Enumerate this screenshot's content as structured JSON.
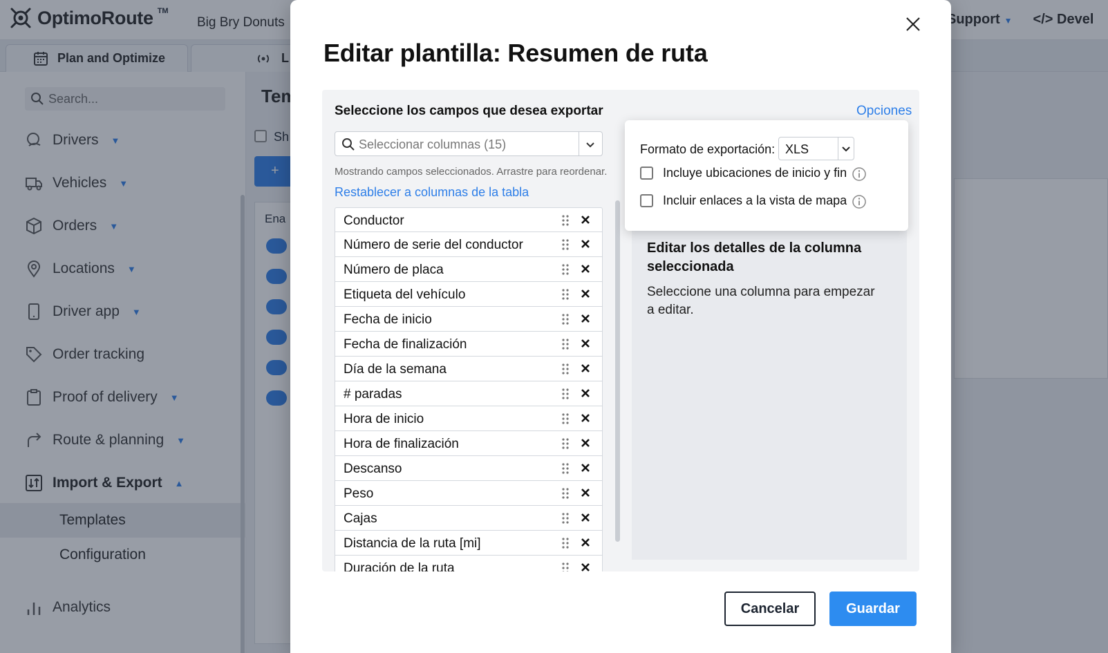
{
  "app": {
    "brand": "OptimoRoute",
    "brand_tm": "TM",
    "company": "Big Bry Donuts",
    "top_links": [
      "Support",
      "Devel"
    ]
  },
  "tabs": [
    {
      "label": "Plan and Optimize",
      "icon": "calendar-icon"
    },
    {
      "label": "L",
      "icon": "live-broadcast-icon"
    }
  ],
  "sidebar": {
    "search_placeholder": "Search...",
    "items": [
      {
        "label": "Drivers",
        "icon": "drivers-icon",
        "caret": true
      },
      {
        "label": "Vehicles",
        "icon": "truck-icon",
        "caret": true
      },
      {
        "label": "Orders",
        "icon": "box-icon",
        "caret": true
      },
      {
        "label": "Locations",
        "icon": "location-pin-icon",
        "caret": true
      },
      {
        "label": "Driver app",
        "icon": "phone-icon",
        "caret": true
      },
      {
        "label": "Order tracking",
        "icon": "tag-icon",
        "caret": false
      },
      {
        "label": "Proof of delivery",
        "icon": "clipboard-icon",
        "caret": true
      },
      {
        "label": "Route & planning",
        "icon": "route-arrow-icon",
        "caret": true
      }
    ],
    "import_export": {
      "label": "Import & Export",
      "icon": "import-export-icon"
    },
    "sub_items": [
      "Templates",
      "Configuration"
    ],
    "analytics": {
      "label": "Analytics",
      "icon": "bar-chart-icon"
    }
  },
  "main": {
    "title_partial": "Tem",
    "check_label_partial": "Sh",
    "add_button_partial": "+",
    "table_header_partial": "Ena"
  },
  "modal": {
    "title": "Editar plantilla: Resumen de ruta",
    "select_fields_title": "Seleccione los campos que desea exportar",
    "options_link": "Opciones",
    "columns_placeholder": "Seleccionar columnas (15)",
    "hint": "Mostrando campos seleccionados. Arrastre para reordenar.",
    "reset_link": "Restablecer a columnas de la tabla",
    "fields": [
      "Conductor",
      "Número de serie del conductor",
      "Número de placa",
      "Etiqueta del vehículo",
      "Fecha de inicio",
      "Fecha de finalización",
      "Día de la semana",
      "# paradas",
      "Hora de inicio",
      "Hora de finalización",
      "Descanso",
      "Peso",
      "Cajas",
      "Distancia de la ruta [mi]",
      "Duración de la ruta"
    ],
    "options": {
      "format_label": "Formato de exportación:",
      "format_value": "XLS",
      "include_start_end": "Incluye ubicaciones de inicio y fin",
      "include_map_links": "Incluir enlaces a la vista de mapa"
    },
    "detail": {
      "title": "Editar los detalles de la columna seleccionada",
      "text": "Seleccione una columna para empezar a editar."
    },
    "cancel_label": "Cancelar",
    "save_label": "Guardar"
  },
  "colors": {
    "accent": "#2d7ee8",
    "save_button": "#2d8cf0",
    "overlay": "rgba(40,50,70,0.48)"
  }
}
